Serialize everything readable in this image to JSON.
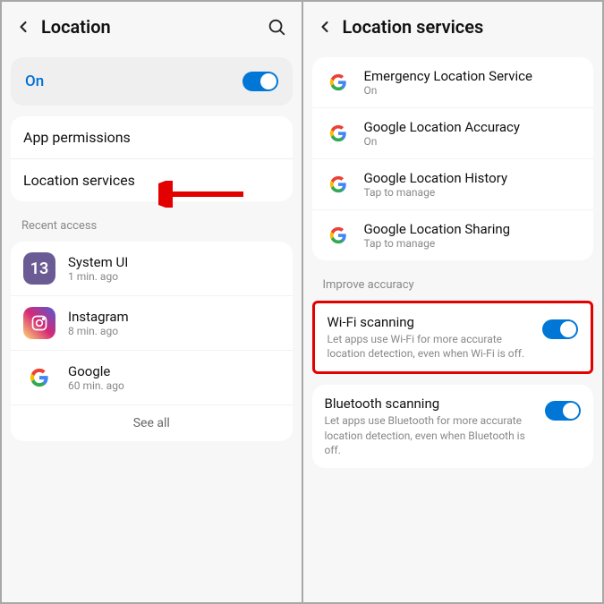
{
  "left": {
    "title": "Location",
    "on_label": "On",
    "rows": {
      "app_permissions": "App permissions",
      "location_services": "Location services"
    },
    "recent_access_label": "Recent access",
    "apps": [
      {
        "name": "System UI",
        "time": "1 min. ago"
      },
      {
        "name": "Instagram",
        "time": "8 min. ago"
      },
      {
        "name": "Google",
        "time": "60 min. ago"
      }
    ],
    "see_all": "See all"
  },
  "right": {
    "title": "Location services",
    "services": [
      {
        "name": "Emergency Location Service",
        "sub": "On"
      },
      {
        "name": "Google Location Accuracy",
        "sub": "On"
      },
      {
        "name": "Google Location History",
        "sub": "Tap to manage"
      },
      {
        "name": "Google Location Sharing",
        "sub": "Tap to manage"
      }
    ],
    "improve_label": "Improve accuracy",
    "wifi": {
      "title": "Wi-Fi scanning",
      "desc": "Let apps use Wi-Fi for more accurate location detection, even when Wi-Fi is off."
    },
    "bt": {
      "title": "Bluetooth scanning",
      "desc": "Let apps use Bluetooth for more accurate location detection, even when Bluetooth is off."
    }
  }
}
